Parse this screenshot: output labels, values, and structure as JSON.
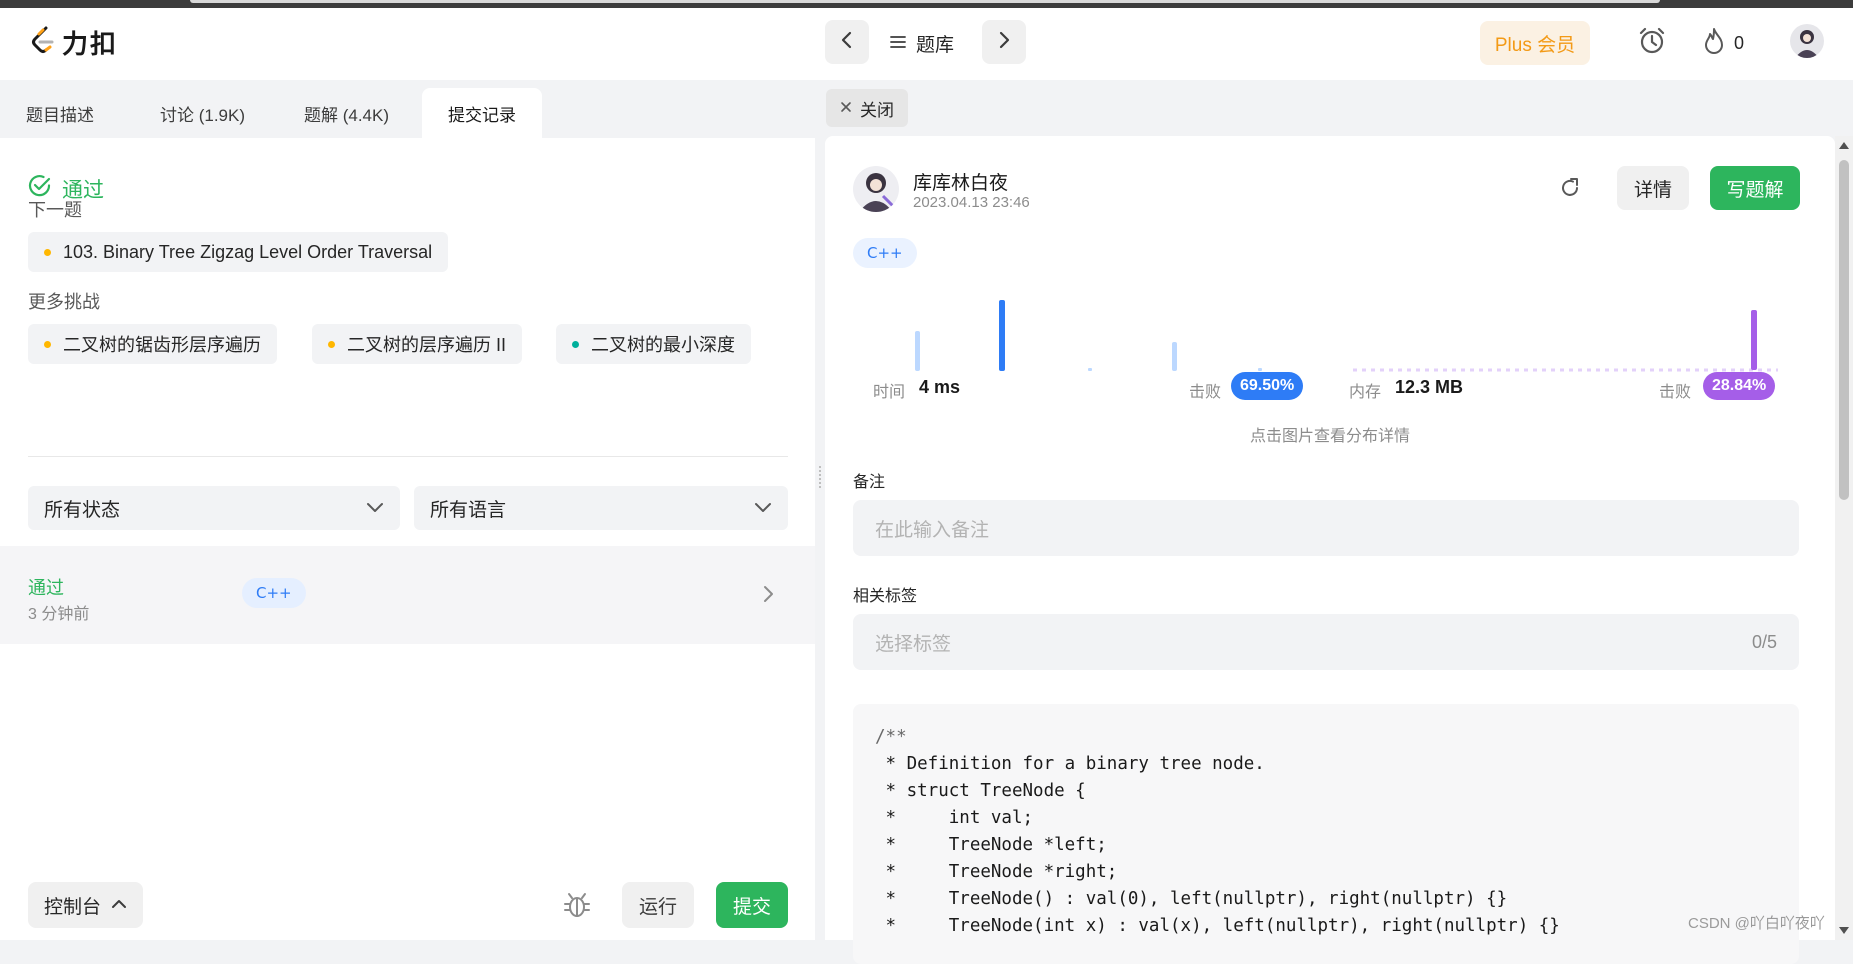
{
  "header": {
    "logo_text": "力扣",
    "problem_bank": "题库",
    "plus_member": "Plus 会员",
    "streak_count": "0"
  },
  "left": {
    "tabs": [
      "题目描述",
      "讨论 (1.9K)",
      "题解 (4.4K)",
      "提交记录"
    ],
    "active_tab": 3,
    "result_status": "通过",
    "next_label": "下一题",
    "next_problem": "103. Binary Tree Zigzag Level Order Traversal",
    "more_label": "更多挑战",
    "challenges": [
      {
        "label": "二叉树的锯齿形层序遍历",
        "dot_color": "#ffb700"
      },
      {
        "label": "二叉树的层序遍历 II",
        "dot_color": "#ffb700"
      },
      {
        "label": "二叉树的最小深度",
        "dot_color": "#00af9b"
      }
    ],
    "filter_status": "所有状态",
    "filter_language": "所有语言",
    "submission": {
      "status": "通过",
      "time_ago": "3 分钟前",
      "language": "C++"
    },
    "console_label": "控制台",
    "run_label": "运行",
    "submit_label": "提交"
  },
  "right": {
    "close_label": "关闭",
    "user_name": "库库林白夜",
    "submit_time": "2023.04.13 23:46",
    "detail_label": "详情",
    "write_solution_label": "写题解",
    "language": "C++",
    "runtime": {
      "label": "时间",
      "value": "4 ms",
      "beats_label": "击败",
      "beats": "69.50%",
      "color": "#2e7cf6"
    },
    "memory": {
      "label": "内存",
      "value": "12.3 MB",
      "beats_label": "击败",
      "beats": "28.84%",
      "color": "#a55ee8"
    },
    "chart_hint": "点击图片查看分布详情",
    "note_label": "备注",
    "note_placeholder": "在此输入备注",
    "tags_label": "相关标签",
    "tags_placeholder": "选择标签",
    "tags_count": "0/5",
    "code_lines": [
      "/**",
      " * Definition for a binary tree node.",
      " * struct TreeNode {",
      " *     int val;",
      " *     TreeNode *left;",
      " *     TreeNode *right;",
      " *     TreeNode() : val(0), left(nullptr), right(nullptr) {}",
      " *     TreeNode(int x) : val(x), left(nullptr), right(nullptr) {}"
    ]
  },
  "watermark": "CSDN @吖白吖夜吖",
  "icons": {
    "logo": "leetcode-logo-icon",
    "prev": "chevron-left-icon",
    "next": "chevron-right-icon",
    "menu": "menu-icon",
    "alarm": "alarm-icon",
    "fire": "fire-icon",
    "pass": "check-circle-icon",
    "close": "close-icon",
    "refresh": "refresh-icon",
    "bug": "bug-icon"
  }
}
